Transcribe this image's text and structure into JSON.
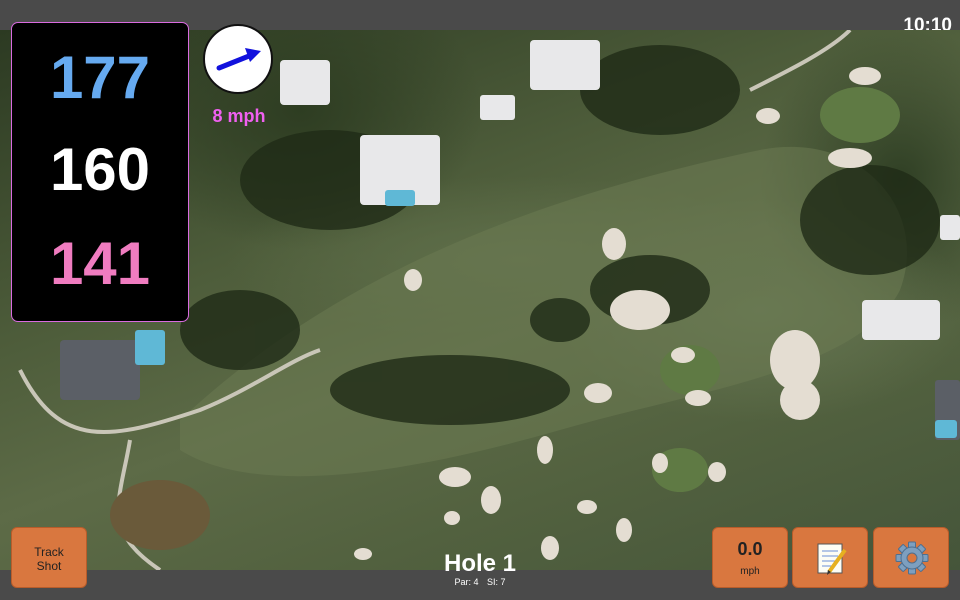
{
  "status_bar": {
    "time": "10:10"
  },
  "distances": {
    "back": "177",
    "middle": "160",
    "front": "141"
  },
  "wind": {
    "speed_label": "8 mph",
    "arrow_icon": "arrow-right-icon"
  },
  "hole": {
    "title": "Hole 1",
    "par_label": "Par: 4",
    "si_label": "SI: 7"
  },
  "buttons": {
    "track_shot_line1": "Track",
    "track_shot_line2": "Shot",
    "wind_value": "0.0",
    "wind_unit": "mph",
    "notes_icon": "notepad-icon",
    "settings_icon": "gear-icon"
  },
  "colors": {
    "back_distance": "#66aaf0",
    "middle_distance": "#ffffff",
    "front_distance": "#f07cc0",
    "wind_label": "#f060f0",
    "button_fill": "#d9773f"
  }
}
